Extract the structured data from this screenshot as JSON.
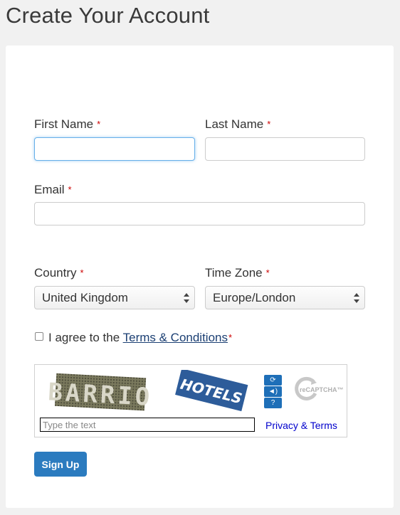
{
  "page": {
    "title": "Create Your Account"
  },
  "form": {
    "required_marker": "*",
    "first_name": {
      "label": "First Name",
      "value": ""
    },
    "last_name": {
      "label": "Last Name",
      "value": ""
    },
    "email": {
      "label": "Email",
      "value": ""
    },
    "country": {
      "label": "Country",
      "selected": "United Kingdom"
    },
    "time_zone": {
      "label": "Time Zone",
      "selected": "Europe/London"
    },
    "agree": {
      "prefix": "I agree to the ",
      "link": "Terms & Conditions",
      "checked": false
    },
    "signup_label": "Sign Up"
  },
  "captcha": {
    "words": [
      "BARRIO",
      "HOTELS"
    ],
    "input_placeholder": "Type the text",
    "privacy_link": "Privacy & Terms",
    "brand": "reCAPTCHA™",
    "icons": [
      "refresh-icon",
      "audio-icon",
      "help-icon"
    ]
  },
  "colors": {
    "accent": "#2b7bbf",
    "required": "#cc0000",
    "focus": "#66afe9",
    "link": "#1b3f73"
  }
}
